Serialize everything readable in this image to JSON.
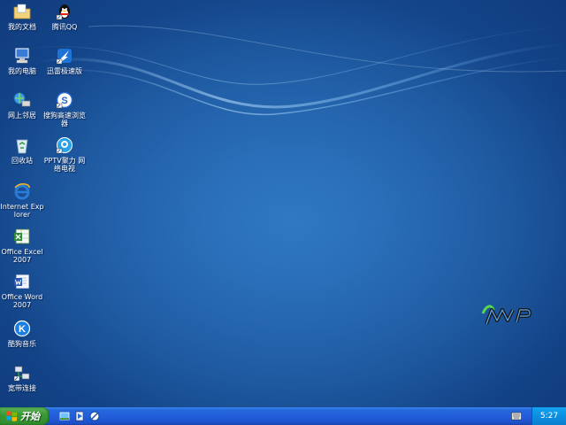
{
  "desktop": {
    "icons": [
      {
        "label": "我的文档",
        "icon": "my-documents-icon"
      },
      {
        "label": "腾讯QQ",
        "icon": "qq-penguin-icon"
      },
      {
        "label": "我的电脑",
        "icon": "my-computer-icon"
      },
      {
        "label": "迅雷极速版",
        "icon": "thunder-download-icon"
      },
      {
        "label": "网上邻居",
        "icon": "network-places-icon"
      },
      {
        "label": "搜狗高速浏览器",
        "icon": "sogou-browser-icon"
      },
      {
        "label": "回收站",
        "icon": "recycle-bin-icon"
      },
      {
        "label": "PPTV聚力 网络电视",
        "icon": "pptv-icon"
      },
      {
        "label": "Internet Explorer",
        "icon": "internet-explorer-icon"
      },
      {
        "label": "Office Excel 2007",
        "icon": "excel-icon"
      },
      {
        "label": "Office Word 2007",
        "icon": "word-icon"
      },
      {
        "label": "酷狗音乐",
        "icon": "kugou-music-icon"
      },
      {
        "label": "宽带连接",
        "icon": "broadband-connection-icon"
      }
    ],
    "logo": "wmp-logo",
    "colors": {
      "background": "#1f5ea8",
      "taskbar": "#245edb",
      "start": "#3a9a35",
      "tray": "#0c8ee0"
    }
  },
  "taskbar": {
    "start_label": "开始",
    "quick_launch": [
      "show-desktop-icon",
      "media-player-icon",
      "browser-quick-icon"
    ],
    "tray_icon": "keyboard-icon",
    "clock": "5:27"
  }
}
